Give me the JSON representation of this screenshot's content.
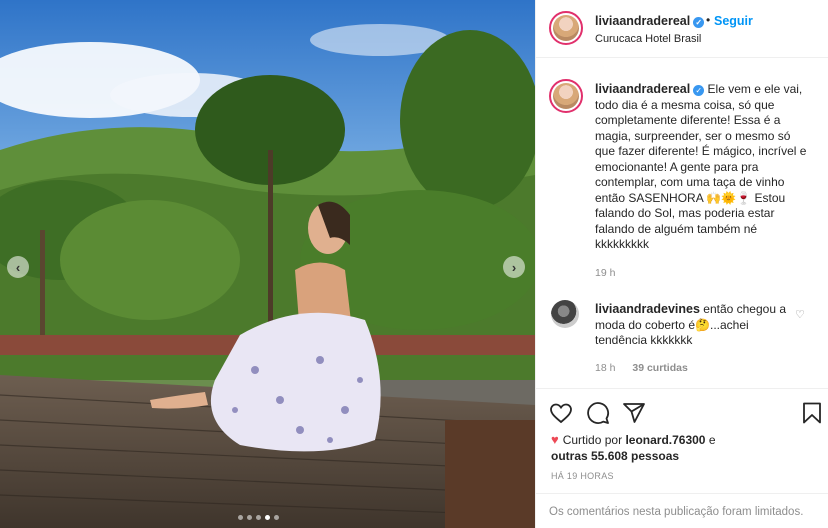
{
  "post": {
    "username": "liviaandradereal",
    "verified_mark": "✓",
    "separator": "•",
    "follow_label": "Seguir",
    "location": "Curucaca Hotel Brasil"
  },
  "caption": {
    "username": "liviaandradereal",
    "text": "Ele vem e ele vai, todo dia é a mesma coisa, só que completamente diferente! Essa é a magia, surpreender, ser o mesmo só que fazer diferente! É mágico, incrível e emocionante! A gente para pra contemplar, com uma taça de vinho então SASENHORA 🙌🌞🍷 Estou falando do Sol, mas poderia estar falando de alguém também né kkkkkkkkk",
    "time": "19 h"
  },
  "comment": {
    "username": "liviaandradevines",
    "text": "então chegou a moda do coberto é🤔...achei tendência kkkkkkk",
    "time": "18 h",
    "likes_label": "39 curtidas"
  },
  "likes": {
    "prefix": "Curtido por",
    "user": "leonard.76300",
    "conj": "e",
    "others": "outras 55.608 pessoas"
  },
  "posted_time": "HÁ 19 HORAS",
  "comments_limited": "Os comentários nesta publicação foram limitados.",
  "carousel": {
    "count": 5,
    "active_index": 3
  },
  "icons": {
    "prev": "chevron-left-icon",
    "next": "chevron-right-icon",
    "like": "heart-icon",
    "comment": "comment-icon",
    "share": "send-icon",
    "save": "bookmark-icon"
  },
  "colors": {
    "accent": "#0095f6",
    "like": "#ed4956",
    "verified": "#3897f0",
    "muted": "#8e8e8e"
  }
}
